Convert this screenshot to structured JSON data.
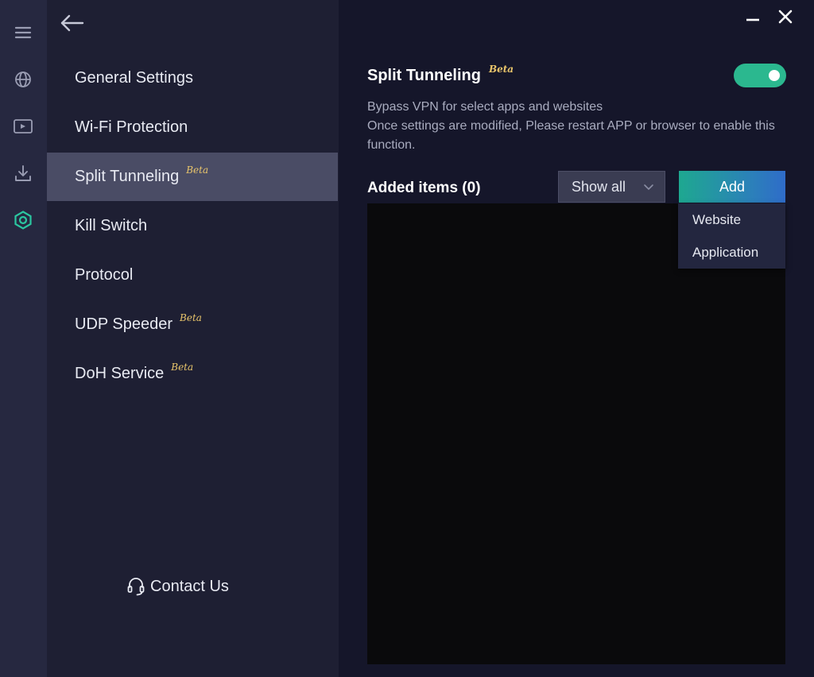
{
  "rail": {
    "icons": [
      "menu-icon",
      "globe-icon",
      "media-icon",
      "download-icon",
      "settings-icon"
    ],
    "active_color": "#2bc6a0"
  },
  "menu": {
    "items": [
      {
        "label": "General Settings",
        "beta": ""
      },
      {
        "label": "Wi-Fi Protection",
        "beta": ""
      },
      {
        "label": "Split Tunneling",
        "beta": "Beta"
      },
      {
        "label": "Kill Switch",
        "beta": ""
      },
      {
        "label": "Protocol",
        "beta": ""
      },
      {
        "label": "UDP Speeder",
        "beta": "Beta"
      },
      {
        "label": "DoH Service",
        "beta": "Beta"
      }
    ],
    "active_index": 2,
    "contact_label": "Contact Us"
  },
  "main": {
    "title": "Split Tunneling",
    "title_badge": "Beta",
    "toggle_on": true,
    "desc_line1": "Bypass VPN for select apps and websites",
    "desc_line2": "Once settings are modified, Please restart APP or browser to enable this function.",
    "added_items_label": "Added items (0)",
    "filter_value": "Show all",
    "add_label": "Add",
    "dropdown_items": [
      "Website",
      "Application"
    ]
  },
  "colors": {
    "accent": "#2bb88f",
    "beta": "#e9c56b"
  }
}
